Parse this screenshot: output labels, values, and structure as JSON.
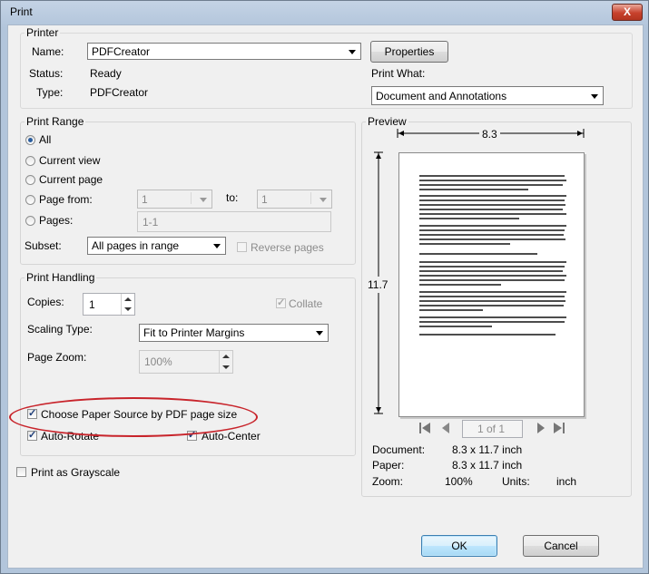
{
  "window": {
    "title": "Print",
    "close_label": "X"
  },
  "printer": {
    "group_label": "Printer",
    "name_label": "Name:",
    "name_value": "PDFCreator",
    "status_label": "Status:",
    "status_value": "Ready",
    "type_label": "Type:",
    "type_value": "PDFCreator",
    "properties_label": "Properties",
    "print_what_label": "Print What:",
    "print_what_value": "Document and Annotations"
  },
  "print_range": {
    "group_label": "Print Range",
    "all_label": "All",
    "current_view_label": "Current view",
    "current_page_label": "Current page",
    "page_from_label": "Page from:",
    "page_from_value": "1",
    "to_label": "to:",
    "to_value": "1",
    "pages_label": "Pages:",
    "pages_value": "1-1",
    "subset_label": "Subset:",
    "subset_value": "All pages in range",
    "reverse_pages_label": "Reverse pages",
    "selected": "All"
  },
  "print_handling": {
    "group_label": "Print Handling",
    "copies_label": "Copies:",
    "copies_value": "1",
    "collate_label": "Collate",
    "collate_checked": true,
    "scaling_label": "Scaling Type:",
    "scaling_value": "Fit to Printer Margins",
    "zoom_label": "Page Zoom:",
    "zoom_value": "100%",
    "paper_source_label": "Choose Paper Source by PDF page size",
    "paper_source_checked": true,
    "auto_rotate_label": "Auto-Rotate",
    "auto_rotate_checked": true,
    "auto_center_label": "Auto-Center",
    "auto_center_checked": true
  },
  "grayscale": {
    "label": "Print as Grayscale",
    "checked": false
  },
  "preview": {
    "group_label": "Preview",
    "width_dim": "8.3",
    "height_dim": "11.7",
    "page_indicator": "1 of 1",
    "document_label": "Document:",
    "document_value": "8.3 x 11.7 inch",
    "paper_label": "Paper:",
    "paper_value": "8.3 x 11.7 inch",
    "zoom_label": "Zoom:",
    "zoom_value": "100%",
    "units_label": "Units:",
    "units_value": "inch"
  },
  "buttons": {
    "ok_label": "OK",
    "cancel_label": "Cancel"
  },
  "colors": {
    "highlight_oval": "#c8242b",
    "title_gradient": "#b2c5db",
    "ok_button": "#a7d9f5"
  }
}
